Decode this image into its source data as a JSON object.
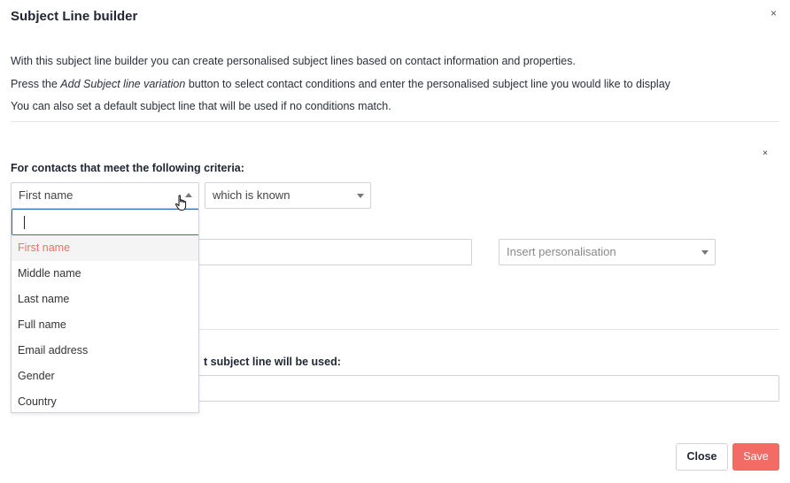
{
  "modal": {
    "title": "Subject Line builder",
    "close_glyph": "×"
  },
  "intro": {
    "line1": "With this subject line builder you can create personalised subject lines based on contact information and properties.",
    "line2_prefix": "Press the ",
    "line2_em": "Add Subject line variation",
    "line2_suffix": " button to select contact conditions and enter the personalised subject line you would like to display",
    "line3": "You can also set a default subject line that will be used if no conditions match."
  },
  "rule": {
    "remove_glyph": "×",
    "criteria_label": "For contacts that meet the following criteria:",
    "field_select": {
      "value": "First name"
    },
    "condition_select": {
      "value": "which is known"
    },
    "personalisation_select": {
      "placeholder": "Insert personalisation"
    }
  },
  "dropdown": {
    "search_value": "",
    "options": [
      "First name",
      "Middle name",
      "Last name",
      "Full name",
      "Email address",
      "Gender",
      "Country"
    ],
    "selected_index": 0
  },
  "default_section": {
    "label_visible": "t subject line will be used:"
  },
  "footer": {
    "close_label": "Close",
    "save_label": "Save"
  },
  "colors": {
    "accent": "#f26b65",
    "selected_option_text": "#f07066",
    "focus_border": "#2a6fb5"
  },
  "icons": {
    "modal_close": "close-icon",
    "rule_remove": "close-icon",
    "mouse": "hand-pointer-icon"
  }
}
